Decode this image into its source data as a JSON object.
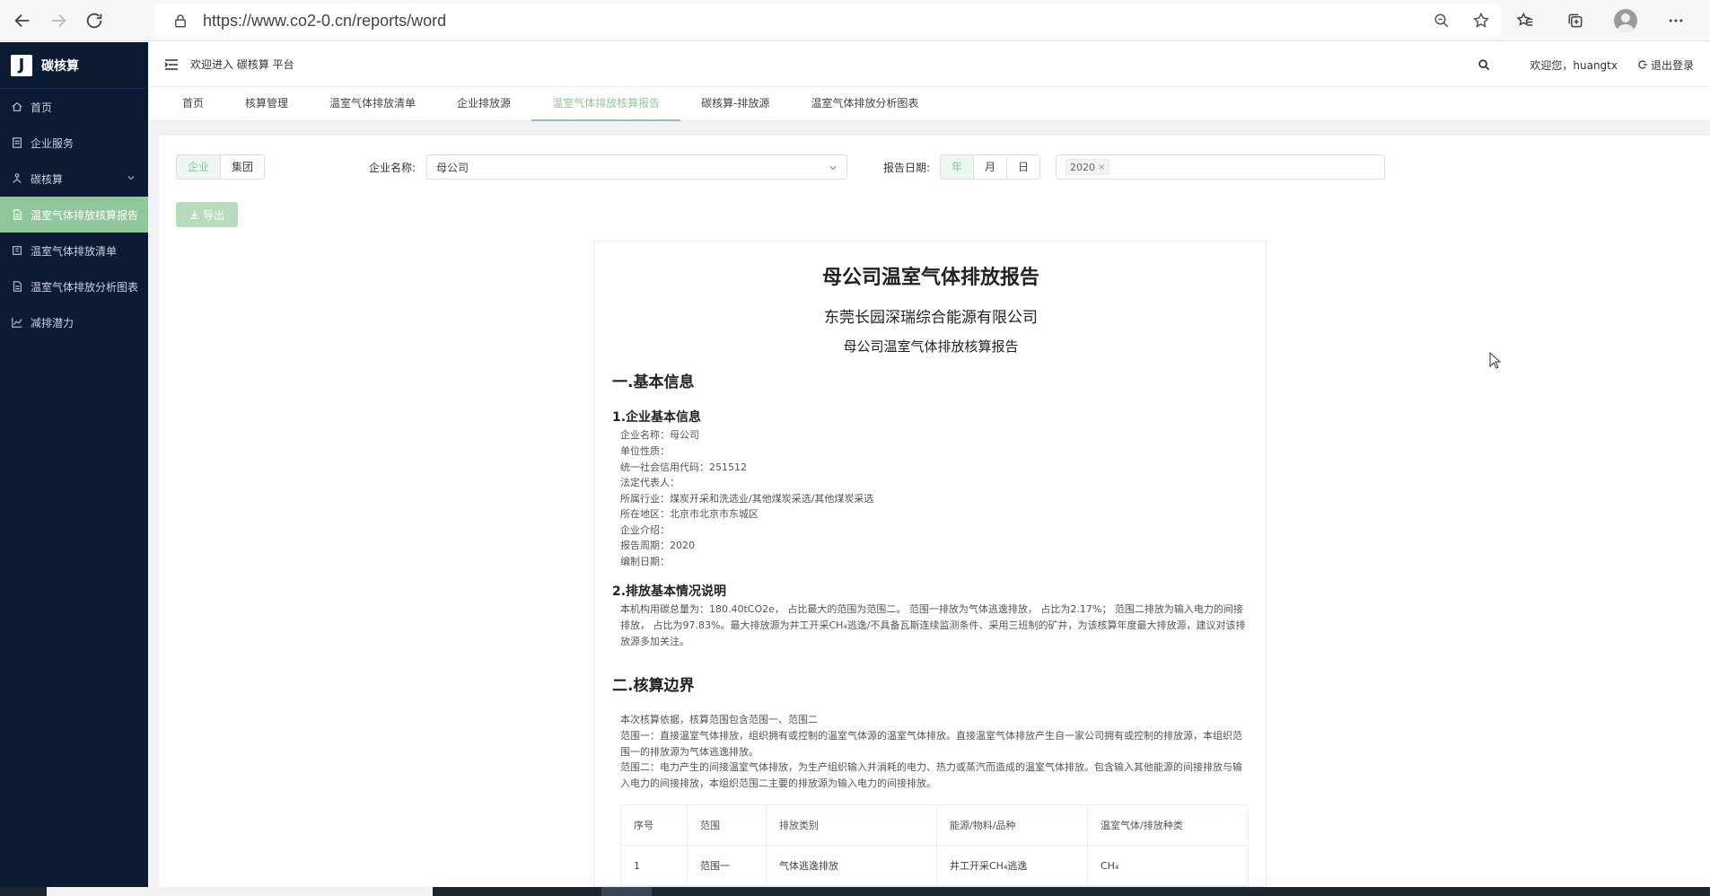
{
  "browser": {
    "url": "https://www.co2-0.cn/reports/word"
  },
  "sidebar": {
    "logo_letter": "J",
    "logo_text": "碳核算",
    "items": [
      {
        "label": "首页"
      },
      {
        "label": "企业服务"
      },
      {
        "label": "碳核算"
      },
      {
        "label": "温室气体排放核算报告"
      },
      {
        "label": "温室气体排放清单"
      },
      {
        "label": "温室气体排放分析图表"
      },
      {
        "label": "减排潜力"
      }
    ]
  },
  "header": {
    "welcome": "欢迎进入 碳核算 平台",
    "user_greeting": "欢迎您，huangtx",
    "logout": "退出登录"
  },
  "tabs": [
    {
      "label": "首页"
    },
    {
      "label": "核算管理"
    },
    {
      "label": "温室气体排放清单"
    },
    {
      "label": "企业排放源"
    },
    {
      "label": "温室气体排放核算报告"
    },
    {
      "label": "碳核算-排放源"
    },
    {
      "label": "温室气体排放分析图表"
    }
  ],
  "filters": {
    "scope_options": [
      "企业",
      "集团"
    ],
    "company_label": "企业名称:",
    "company_value": "母公司",
    "date_label": "报告日期:",
    "date_options": [
      "年",
      "月",
      "日"
    ],
    "year_tag": "2020",
    "export_label": "导出"
  },
  "report": {
    "title": "母公司温室气体排放报告",
    "company": "东莞长园深瑞综合能源有限公司",
    "subtitle": "母公司温室气体排放核算报告",
    "section1": "一.基本信息",
    "s1_1": "1.企业基本信息",
    "info_lines": [
      "企业名称：母公司",
      "单位性质：",
      "统一社会信用代码：251512",
      "法定代表人：",
      "所属行业：煤炭开采和洗选业/其他煤炭采选/其他煤炭采选",
      "所在地区：北京市北京市东城区",
      "企业介绍：",
      "报告周期：2020",
      "编制日期："
    ],
    "s1_2": "2.排放基本情况说明",
    "s1_2_para": "本机构用碳总量为：180.40tCO2e， 占比最大的范围为范围二。 范围一排放为气体逃逸排放， 占比为2.17%； 范围二排放为输入电力的间接排放， 占比为97.83%。最大排放源为井工开采CH₄逃逸/不具备瓦斯连续监测条件、采用三班制的矿井，为该核算年度最大排放源，建议对该排放源多加关注。",
    "section2": "二.核算边界",
    "s2_lines": [
      "本次核算依据，核算范围包含范围一、范围二",
      "范围一：直接温室气体排放，组织拥有或控制的温室气体源的温室气体排放。直接温室气体排放产生自一家公司拥有或控制的排放源，本组织范围一的排放源为气体逃逸排放。",
      "范围二：电力产生的间接温室气体排放，为生产组织输入并消耗的电力、热力或蒸汽而造成的温室气体排放。包含输入其他能源的间接排放与输入电力的间接排放，本组织范围二主要的排放源为输入电力的间接排放。"
    ],
    "table": {
      "headers": [
        "序号",
        "范围",
        "排放类别",
        "能源/物料/品种",
        "温室气体/排放种类"
      ],
      "rows": [
        [
          "1",
          "范围一",
          "气体逃逸排放",
          "井工开采CH₄逃逸",
          "CH₄"
        ]
      ]
    }
  },
  "colors": {
    "sidebar_bg": "#0b1b33",
    "accent": "#8fc79a"
  }
}
